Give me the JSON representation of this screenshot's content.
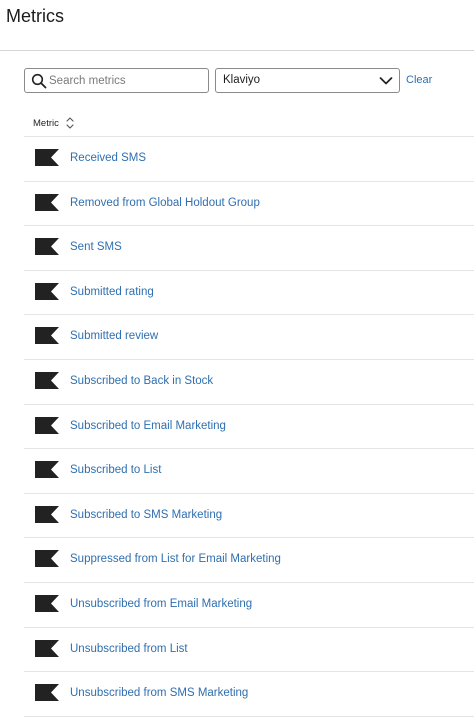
{
  "header": {
    "title": "Metrics"
  },
  "filters": {
    "search_placeholder": "Search metrics",
    "search_value": "",
    "source_select_value": "Klaviyo",
    "clear_label": "Clear"
  },
  "table": {
    "column_label": "Metric",
    "rows": [
      {
        "name": "Received SMS",
        "icon": "flag-icon"
      },
      {
        "name": "Removed from Global Holdout Group",
        "icon": "flag-icon"
      },
      {
        "name": "Sent SMS",
        "icon": "flag-icon"
      },
      {
        "name": "Submitted rating",
        "icon": "flag-icon"
      },
      {
        "name": "Submitted review",
        "icon": "flag-icon"
      },
      {
        "name": "Subscribed to Back in Stock",
        "icon": "flag-icon"
      },
      {
        "name": "Subscribed to Email Marketing",
        "icon": "flag-icon"
      },
      {
        "name": "Subscribed to List",
        "icon": "flag-icon"
      },
      {
        "name": "Subscribed to SMS Marketing",
        "icon": "flag-icon"
      },
      {
        "name": "Suppressed from List for Email Marketing",
        "icon": "flag-icon"
      },
      {
        "name": "Unsubscribed from Email Marketing",
        "icon": "flag-icon"
      },
      {
        "name": "Unsubscribed from List",
        "icon": "flag-icon"
      },
      {
        "name": "Unsubscribed from SMS Marketing",
        "icon": "flag-icon"
      }
    ]
  },
  "colors": {
    "link": "#2f6fb0",
    "icon": "#222222",
    "divider": "#e4e4e4"
  }
}
